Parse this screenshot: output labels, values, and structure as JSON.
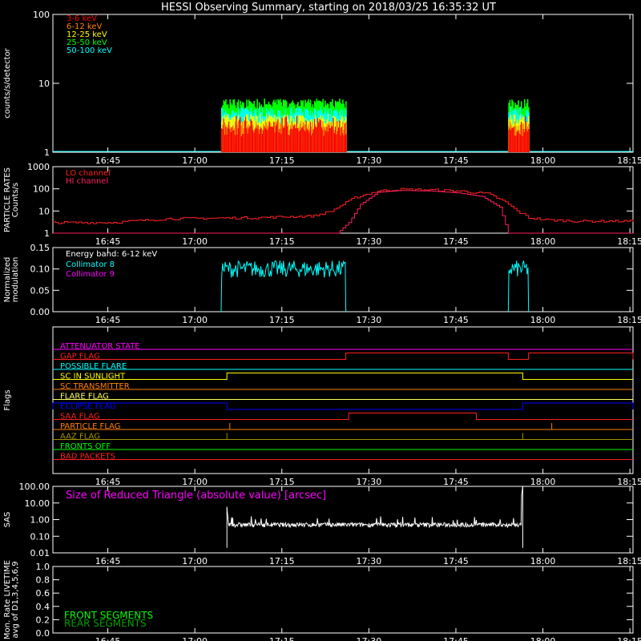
{
  "title": "HESSI Observing Summary, starting on 2018/03/25 16:35:32 UT",
  "time_ticks": [
    "16:45",
    "17:00",
    "17:15",
    "17:30",
    "17:45",
    "18:00",
    "18:15"
  ],
  "chart_data": [
    {
      "panel": "count-rates",
      "type": "bar",
      "ylabel": "counts/s/detector",
      "yscale": "log",
      "ylim": [
        1,
        100
      ],
      "yticks": [
        "1",
        "10",
        "100"
      ],
      "xrange_minutes": [
        16.4667,
        100
      ],
      "legend": [
        {
          "label": "3-6 keV",
          "color": "#ff0000"
        },
        {
          "label": "6-12 keV",
          "color": "#ff8000"
        },
        {
          "label": "12-25 keV",
          "color": "#ffff00"
        },
        {
          "label": "25-50 keV",
          "color": "#00ff00"
        },
        {
          "label": "50-100 keV",
          "color": "#00ffff"
        }
      ],
      "data_intervals_minutes": [
        [
          29,
          50.5
        ],
        [
          78.5,
          82
        ]
      ],
      "typical_levels": {
        "3-6 keV": 2.0,
        "6-12 keV": 2.4,
        "12-25 keV": 3.0,
        "25-50 keV": 5.0,
        "50-100 keV": 3.8
      }
    },
    {
      "panel": "particle-rates",
      "type": "line",
      "ylabel": "PARTICLE RATES Counts/s",
      "yscale": "log",
      "ylim": [
        1,
        1000
      ],
      "yticks": [
        "1",
        "10",
        "100",
        "1000"
      ],
      "legend": [
        {
          "label": "LO channel",
          "color": "#ff2020"
        },
        {
          "label": "HI channel",
          "color": "#ff2060"
        }
      ],
      "series": [
        {
          "name": "LO channel",
          "color": "#ff2020",
          "x": [
            0,
            10,
            20,
            35,
            45,
            48,
            52,
            56,
            60,
            65,
            70,
            75,
            78,
            80,
            82,
            85,
            90,
            100
          ],
          "y": [
            3,
            3,
            4.5,
            5,
            6,
            10,
            40,
            80,
            95,
            90,
            80,
            60,
            25,
            10,
            5,
            4,
            3.5,
            3.5
          ]
        },
        {
          "name": "HI channel",
          "color": "#ff2060",
          "x": [
            0,
            49,
            51,
            53,
            56,
            60,
            65,
            70,
            74,
            77,
            78.5,
            100
          ],
          "y": [
            1,
            1,
            3,
            20,
            70,
            85,
            80,
            65,
            45,
            15,
            1,
            1
          ]
        }
      ]
    },
    {
      "panel": "modulation",
      "type": "line",
      "ylabel": "Normalized modulation",
      "ylim": [
        0,
        0.15
      ],
      "yticks": [
        "0.00",
        "0.05",
        "0.10",
        "0.15"
      ],
      "annotation": "Energy band: 6-12 keV",
      "legend": [
        {
          "label": "Collimator 8",
          "color": "#00ffff"
        },
        {
          "label": "Collimator 9",
          "color": "#ff00ff"
        }
      ],
      "data_intervals_minutes": [
        [
          29,
          50.5
        ],
        [
          78.5,
          82
        ]
      ],
      "typical_value": 0.1
    },
    {
      "panel": "flags",
      "type": "line",
      "ylabel": "Flags",
      "flags": [
        {
          "label": "ATTENUATOR STATE",
          "color": "#ff00ff",
          "steps": []
        },
        {
          "label": "GAP FLAG",
          "color": "#ff2020",
          "steps": [
            [
              50.5,
              78.5
            ],
            [
              82,
              100
            ]
          ]
        },
        {
          "label": "POSSIBLE FLARE",
          "color": "#00ffff",
          "steps": []
        },
        {
          "label": "SC IN SUNLIGHT",
          "color": "#ffff00",
          "steps": [
            [
              30,
              81
            ]
          ]
        },
        {
          "label": "SC TRANSMITTER",
          "color": "#ff8000",
          "steps": []
        },
        {
          "label": "FLARE FLAG",
          "color": "#ffff60",
          "steps": []
        },
        {
          "label": "ECLIPSE FLAG",
          "color": "#0000ff",
          "steps": [
            [
              0,
              30
            ],
            [
              81,
              100
            ]
          ]
        },
        {
          "label": "SAA FLAG",
          "color": "#ff2020",
          "steps": [
            [
              51,
              73
            ]
          ]
        },
        {
          "label": "PARTICLE FLAG",
          "color": "#ff8000",
          "spikes": [
            30.5,
            86
          ]
        },
        {
          "label": "AAZ FLAG",
          "color": "#a09000",
          "spikes": [
            30,
            81
          ]
        },
        {
          "label": "FRONTS OFF",
          "color": "#00ff00",
          "steps": []
        },
        {
          "label": "BAD PACKETS",
          "color": "#ff2020",
          "steps": []
        }
      ]
    },
    {
      "panel": "sas",
      "type": "line",
      "ylabel": "SAS",
      "yscale": "log",
      "ylim": [
        0.01,
        100
      ],
      "yticks": [
        "0.01",
        "0.10",
        "1.00",
        "10.00",
        "100.00"
      ],
      "annotation": "Size of Reduced Triangle (absolute value) [arcsec]",
      "series": [
        {
          "name": "",
          "color": "#ffffff",
          "x": [
            30,
            30.5,
            31,
            40,
            50,
            60,
            70,
            80,
            80.8,
            81
          ],
          "y": [
            5,
            0.6,
            0.5,
            0.5,
            0.5,
            0.6,
            0.6,
            0.7,
            30,
            50
          ]
        }
      ]
    },
    {
      "panel": "livetime",
      "type": "line",
      "ylabel": "Mon. Rate LIVETIME avg of D1,3,4,5,6,9",
      "ylim": [
        0,
        1
      ],
      "yticks": [
        "0.0",
        "0.2",
        "0.4",
        "0.6",
        "0.8",
        "1.0"
      ],
      "legend": [
        {
          "label": "FRONT SEGMENTS",
          "color": "#00ff00"
        },
        {
          "label": "REAR SEGMENTS",
          "color": "#00a000"
        }
      ]
    }
  ]
}
